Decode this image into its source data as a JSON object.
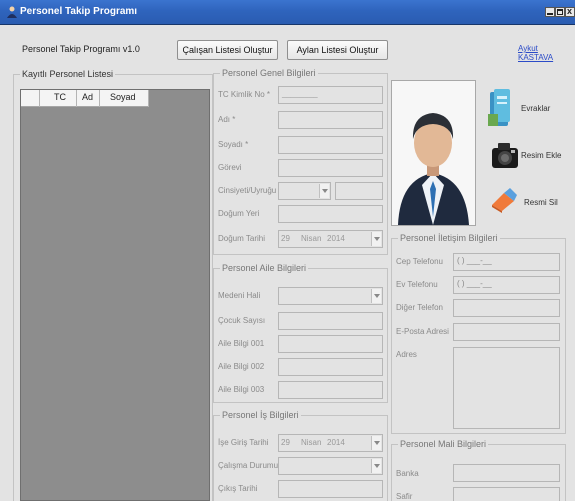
{
  "window": {
    "title": "Personel Takip Programı"
  },
  "toolbar": {
    "version": "Personel Takip Programı v1.0",
    "list_button": "Çalışan Listesi Oluştur",
    "monthly_button": "Aylan Listesi Oluştur",
    "author_link": "Aykut KASTAVA"
  },
  "registered": {
    "title": "Kayıtlı Personel Listesi",
    "columns": [
      "TC",
      "Ad",
      "Soyad"
    ]
  },
  "general": {
    "title": "Personel Genel Bilgileri",
    "tc_label": "TC Kimlik No *",
    "tc_value": "________",
    "name_label": "Adı *",
    "surname_label": "Soyadı *",
    "duty_label": "Görevi",
    "gender_label": "Cinsiyeti/Uyruğu",
    "birthplace_label": "Doğum Yeri",
    "birthdate_label": "Doğum Tarihi",
    "birthdate_value": {
      "day": "29",
      "month": "Nisan",
      "year": "2014"
    }
  },
  "family": {
    "title": "Personel Aile Bilgileri",
    "marital_label": "Medeni Hali",
    "children_label": "Çocuk Sayısı",
    "info1_label": "Aile Bilgi 001",
    "info2_label": "Aile Bilgi 002",
    "info3_label": "Aile Bilgi 003"
  },
  "work": {
    "title": "Personel İş Bilgileri",
    "start_label": "İşe Giriş Tarihi",
    "start_value": {
      "day": "29",
      "month": "Nisan",
      "year": "2014"
    },
    "status_label": "Çalışma Durumu",
    "end_label": "Çıkış Tarihi"
  },
  "contact": {
    "title": "Personel İletişim Bilgileri",
    "mobile_label": "Cep Telefonu",
    "mobile_value": "(   ) ___-__",
    "home_label": "Ev Telefonu",
    "home_value": "(   ) ___-__",
    "other_label": "Diğer Telefon",
    "email_label": "E-Posta Adresi",
    "address_label": "Adres"
  },
  "finance": {
    "title": "Personel Mali Bilgileri",
    "bank_label": "Banka",
    "salary_label": "Safir"
  },
  "actions": {
    "documents": "Evraklar",
    "add_photo": "Resim Ekle",
    "delete_photo": "Resmi Sil"
  }
}
